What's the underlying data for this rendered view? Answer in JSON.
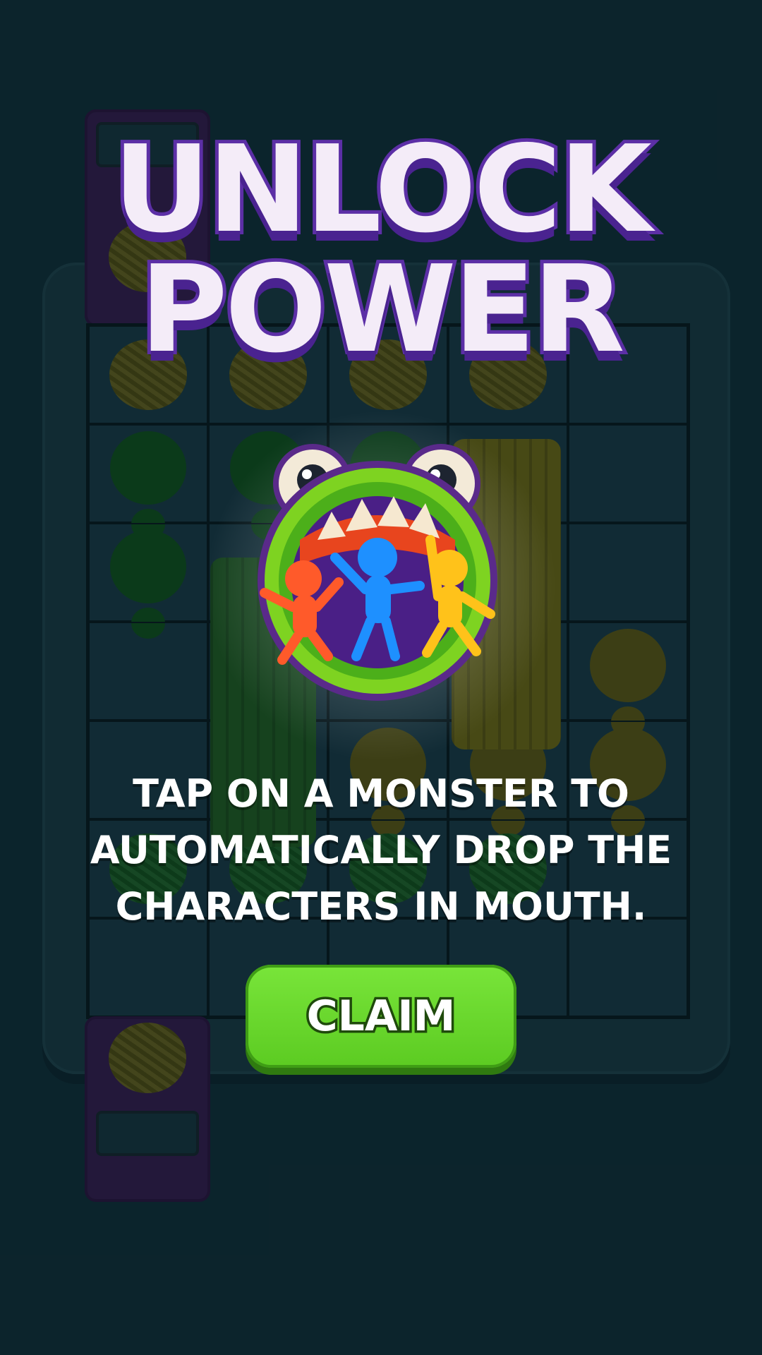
{
  "popup": {
    "title_line1": "UNLOCK",
    "title_line2": "POWER",
    "instruction_line1": "TAP ON A MONSTER TO",
    "instruction_line2": "AUTOMATICALLY DROP THE",
    "instruction_line3": "CHARACTERS IN MOUTH.",
    "claim_label": "CLAIM"
  },
  "icons": {
    "power": "monster-mouth-icon"
  },
  "colors": {
    "background": "#0f2b35",
    "title_outline": "#5c2fa6",
    "claim_button": "#66d42c"
  }
}
